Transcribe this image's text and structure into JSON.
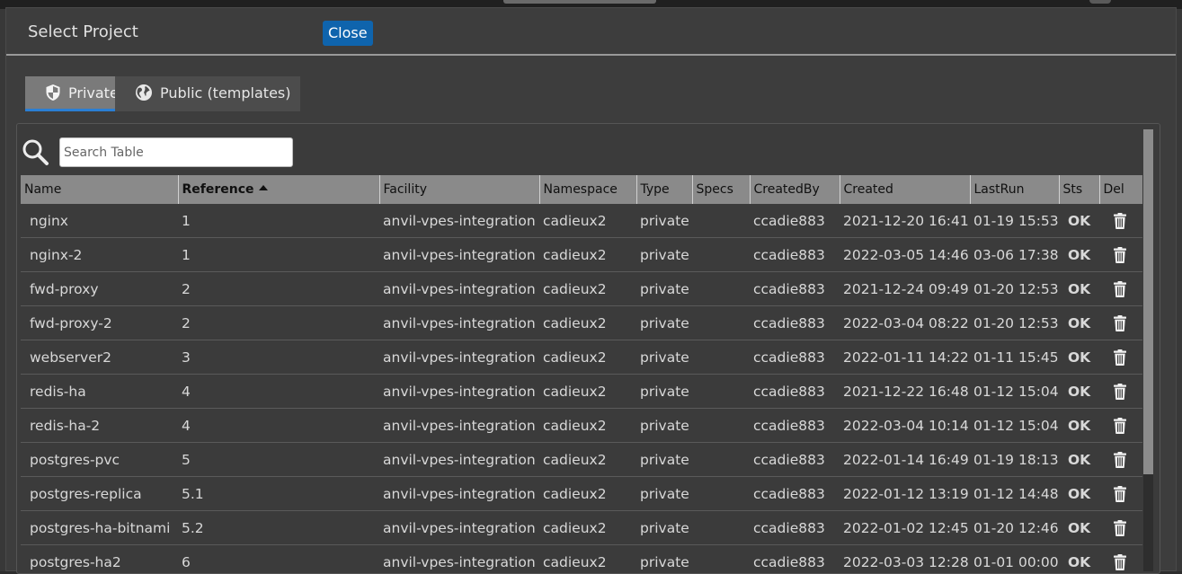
{
  "dialog": {
    "title": "Select Project",
    "close_label": "Close"
  },
  "tabs": [
    {
      "label": "Private",
      "icon": "shield-icon",
      "active": true
    },
    {
      "label": "Public (templates)",
      "icon": "globe-icon",
      "active": false
    }
  ],
  "search": {
    "placeholder": "Search Table",
    "value": ""
  },
  "table": {
    "sorted_column": "Reference",
    "sort_direction": "ascending",
    "columns": [
      "Name",
      "Reference",
      "Facility",
      "Namespace",
      "Type",
      "Specs",
      "CreatedBy",
      "Created",
      "LastRun",
      "Sts",
      "Del"
    ],
    "rows": [
      {
        "name": "nginx",
        "reference": "1",
        "facility": "anvil-vpes-integration",
        "namespace": "cadieux2",
        "type": "private",
        "specs": "",
        "created_by": "ccadie883",
        "created": "2021-12-20 16:41",
        "last_run": "01-19 15:53",
        "sts": "OK"
      },
      {
        "name": "nginx-2",
        "reference": "1",
        "facility": "anvil-vpes-integration",
        "namespace": "cadieux2",
        "type": "private",
        "specs": "",
        "created_by": "ccadie883",
        "created": "2022-03-05 14:46",
        "last_run": "03-06 17:38",
        "sts": "OK"
      },
      {
        "name": "fwd-proxy",
        "reference": "2",
        "facility": "anvil-vpes-integration",
        "namespace": "cadieux2",
        "type": "private",
        "specs": "",
        "created_by": "ccadie883",
        "created": "2021-12-24 09:49",
        "last_run": "01-20 12:53",
        "sts": "OK"
      },
      {
        "name": "fwd-proxy-2",
        "reference": "2",
        "facility": "anvil-vpes-integration",
        "namespace": "cadieux2",
        "type": "private",
        "specs": "",
        "created_by": "ccadie883",
        "created": "2022-03-04 08:22",
        "last_run": "01-20 12:53",
        "sts": "OK"
      },
      {
        "name": "webserver2",
        "reference": "3",
        "facility": "anvil-vpes-integration",
        "namespace": "cadieux2",
        "type": "private",
        "specs": "",
        "created_by": "ccadie883",
        "created": "2022-01-11 14:22",
        "last_run": "01-11 15:45",
        "sts": "OK"
      },
      {
        "name": "redis-ha",
        "reference": "4",
        "facility": "anvil-vpes-integration",
        "namespace": "cadieux2",
        "type": "private",
        "specs": "",
        "created_by": "ccadie883",
        "created": "2021-12-22 16:48",
        "last_run": "01-12 15:04",
        "sts": "OK"
      },
      {
        "name": "redis-ha-2",
        "reference": "4",
        "facility": "anvil-vpes-integration",
        "namespace": "cadieux2",
        "type": "private",
        "specs": "",
        "created_by": "ccadie883",
        "created": "2022-03-04 10:14",
        "last_run": "01-12 15:04",
        "sts": "OK"
      },
      {
        "name": "postgres-pvc",
        "reference": "5",
        "facility": "anvil-vpes-integration",
        "namespace": "cadieux2",
        "type": "private",
        "specs": "",
        "created_by": "ccadie883",
        "created": "2022-01-14 16:49",
        "last_run": "01-19 18:13",
        "sts": "OK"
      },
      {
        "name": "postgres-replica",
        "reference": "5.1",
        "facility": "anvil-vpes-integration",
        "namespace": "cadieux2",
        "type": "private",
        "specs": "",
        "created_by": "ccadie883",
        "created": "2022-01-12 13:19",
        "last_run": "01-12 14:48",
        "sts": "OK"
      },
      {
        "name": "postgres-ha-bitnami",
        "reference": "5.2",
        "facility": "anvil-vpes-integration",
        "namespace": "cadieux2",
        "type": "private",
        "specs": "",
        "created_by": "ccadie883",
        "created": "2022-01-02 12:45",
        "last_run": "01-20 12:46",
        "sts": "OK"
      },
      {
        "name": "postgres-ha2",
        "reference": "6",
        "facility": "anvil-vpes-integration",
        "namespace": "cadieux2",
        "type": "private",
        "specs": "",
        "created_by": "ccadie883",
        "created": "2022-03-03 12:28",
        "last_run": "01-01 00:00",
        "sts": "OK"
      }
    ]
  },
  "colors": {
    "close_button": "#0f64ad",
    "active_tab_underline": "#2a7fd4",
    "status_ok": "#9be01b",
    "header_bg": "#8a8a8a"
  }
}
